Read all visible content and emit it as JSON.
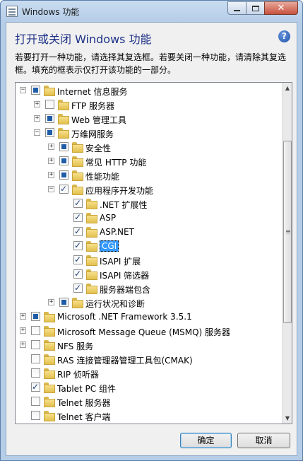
{
  "window": {
    "title": "Windows 功能",
    "heading": "打开或关闭 Windows 功能",
    "description": "若要打开一种功能，请选择其复选框。若要关闭一种功能，请清除其复选框。填充的框表示仅打开该功能的一部分。"
  },
  "tree": [
    {
      "label": "Internet 信息服务",
      "level": 0,
      "expander": "−",
      "check": "partial"
    },
    {
      "label": "FTP 服务器",
      "level": 1,
      "expander": "+",
      "check": "none"
    },
    {
      "label": "Web 管理工具",
      "level": 1,
      "expander": "+",
      "check": "partial"
    },
    {
      "label": "万维网服务",
      "level": 1,
      "expander": "−",
      "check": "partial"
    },
    {
      "label": "安全性",
      "level": 2,
      "expander": "+",
      "check": "partial"
    },
    {
      "label": "常见 HTTP 功能",
      "level": 2,
      "expander": "+",
      "check": "partial"
    },
    {
      "label": "性能功能",
      "level": 2,
      "expander": "+",
      "check": "partial"
    },
    {
      "label": "应用程序开发功能",
      "level": 2,
      "expander": "−",
      "check": "checked"
    },
    {
      "label": ".NET 扩展性",
      "level": 3,
      "expander": "",
      "check": "checked"
    },
    {
      "label": "ASP",
      "level": 3,
      "expander": "",
      "check": "checked"
    },
    {
      "label": "ASP.NET",
      "level": 3,
      "expander": "",
      "check": "checked"
    },
    {
      "label": "CGI",
      "level": 3,
      "expander": "",
      "check": "checked",
      "selected": true
    },
    {
      "label": "ISAPI 扩展",
      "level": 3,
      "expander": "",
      "check": "checked"
    },
    {
      "label": "ISAPI 筛选器",
      "level": 3,
      "expander": "",
      "check": "checked"
    },
    {
      "label": "服务器端包含",
      "level": 3,
      "expander": "",
      "check": "checked"
    },
    {
      "label": "运行状况和诊断",
      "level": 2,
      "expander": "+",
      "check": "partial"
    },
    {
      "label": "Microsoft .NET Framework 3.5.1",
      "level": 0,
      "expander": "+",
      "check": "partial"
    },
    {
      "label": "Microsoft Message Queue (MSMQ) 服务器",
      "level": 0,
      "expander": "+",
      "check": "none"
    },
    {
      "label": "NFS 服务",
      "level": 0,
      "expander": "+",
      "check": "none"
    },
    {
      "label": "RAS 连接管理器管理工具包(CMAK)",
      "level": 0,
      "expander": "",
      "check": "none"
    },
    {
      "label": "RIP 侦听器",
      "level": 0,
      "expander": "",
      "check": "none"
    },
    {
      "label": "Tablet PC 组件",
      "level": 0,
      "expander": "",
      "check": "checked"
    },
    {
      "label": "Telnet 服务器",
      "level": 0,
      "expander": "",
      "check": "none"
    },
    {
      "label": "Telnet 客户端",
      "level": 0,
      "expander": "",
      "check": "none"
    }
  ],
  "buttons": {
    "ok": "确定",
    "cancel": "取消"
  },
  "icons": {
    "help": "?",
    "close": "✕",
    "scroll_up": "▲",
    "scroll_down": "▼"
  }
}
